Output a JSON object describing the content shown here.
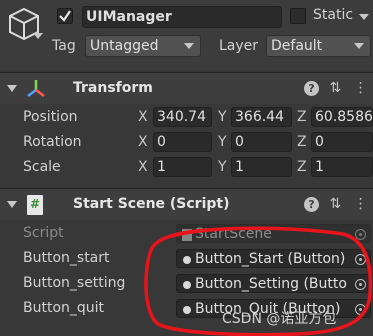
{
  "gameobject": {
    "name": "UIManager",
    "static_label": "Static",
    "tag_label": "Tag",
    "tag_value": "Untagged",
    "layer_label": "Layer",
    "layer_value": "Default"
  },
  "transform": {
    "title": "Transform",
    "position_label": "Position",
    "rotation_label": "Rotation",
    "scale_label": "Scale",
    "axes": {
      "x": "X",
      "y": "Y",
      "z": "Z"
    },
    "position": {
      "x": "340.74",
      "y": "366.44",
      "z": "60.8586"
    },
    "rotation": {
      "x": "0",
      "y": "0",
      "z": "0"
    },
    "scale": {
      "x": "1",
      "y": "1",
      "z": "1"
    }
  },
  "script_component": {
    "title": "Start Scene (Script)",
    "script_label": "Script",
    "script_value": "StartScene",
    "fields": [
      {
        "label": "Button_start",
        "value": "Button_Start (Button)"
      },
      {
        "label": "Button_setting",
        "value": "Button_Setting (Butto"
      },
      {
        "label": "Button_quit",
        "value": "Button_Quit (Button)"
      }
    ]
  },
  "watermark": "CSDN @诺亚方包",
  "colors": {
    "annotation_red": "#e8141b",
    "transform_icon_blue": "#4aa3ff",
    "transform_icon_green": "#7ed957",
    "transform_icon_red": "#ff5a4e",
    "script_icon_green": "#6fcf6f"
  }
}
